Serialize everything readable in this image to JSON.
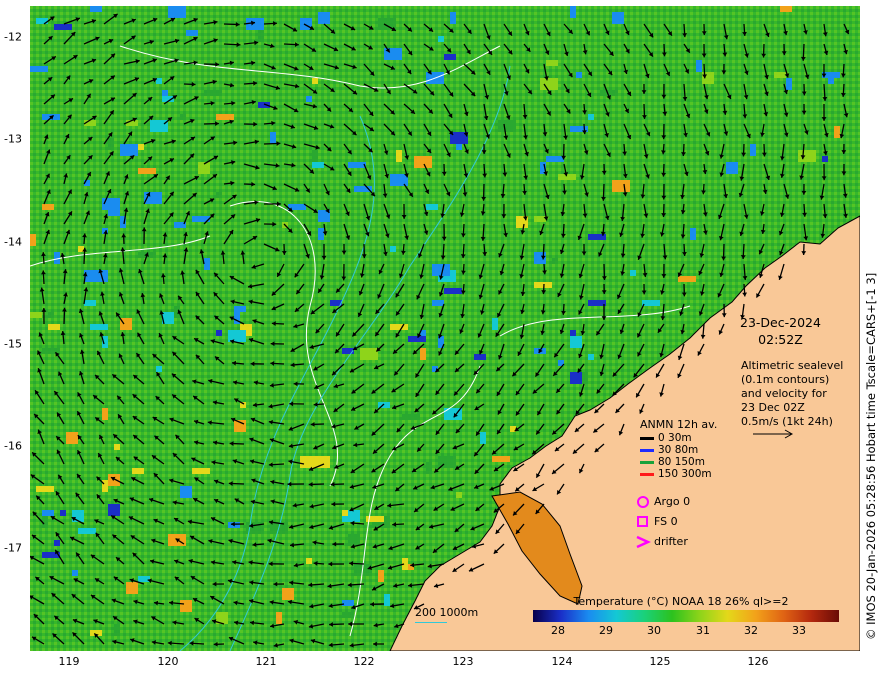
{
  "map": {
    "y_ticks": [
      "-12",
      "-13",
      "-14",
      "-15",
      "-16",
      "-17"
    ],
    "x_ticks": [
      "119",
      "120",
      "121",
      "122",
      "123",
      "124",
      "125",
      "126"
    ]
  },
  "date": {
    "line1": "23-Dec-2024",
    "line2": "02:52Z"
  },
  "altimetry": {
    "lines": [
      "Altimetric sealevel",
      "(0.1m contours)",
      "and velocity for",
      "23 Dec 02Z",
      "0.5m/s (1kt 24h)"
    ]
  },
  "anmn": {
    "title": "ANMN 12h av.",
    "rows": [
      {
        "label": "0 30m",
        "color": "#000000"
      },
      {
        "label": "30 80m",
        "color": "#1e2bff"
      },
      {
        "label": "80 150m",
        "color": "#18a23a"
      },
      {
        "label": "150 300m",
        "color": "#ff1a1a"
      }
    ]
  },
  "markers": [
    {
      "label": "Argo 0",
      "icon": "circle-icon",
      "color": "#ff00ff"
    },
    {
      "label": "FS 0",
      "icon": "square-icon",
      "color": "#ff00ff"
    },
    {
      "label": "drifter",
      "icon": "chevron-icon",
      "color": "#ff00ff"
    }
  ],
  "colorbar": {
    "title": "Temperature (°C) NOAA 18 26% ql>=2",
    "ticks": [
      "28",
      "29",
      "30",
      "31",
      "32",
      "33"
    ]
  },
  "depth_legend": {
    "label": "200  1000m",
    "color": "#31c9d8"
  },
  "credit": "© IMOS 20-Jan-2026 05:28:56 Hobart time Tscale=CARS+[-1 3]",
  "colors": {
    "land": "#f9c897",
    "sea_base": "#3cbf2a",
    "contour": "#ffffff",
    "isobath": "#31c9d8"
  }
}
